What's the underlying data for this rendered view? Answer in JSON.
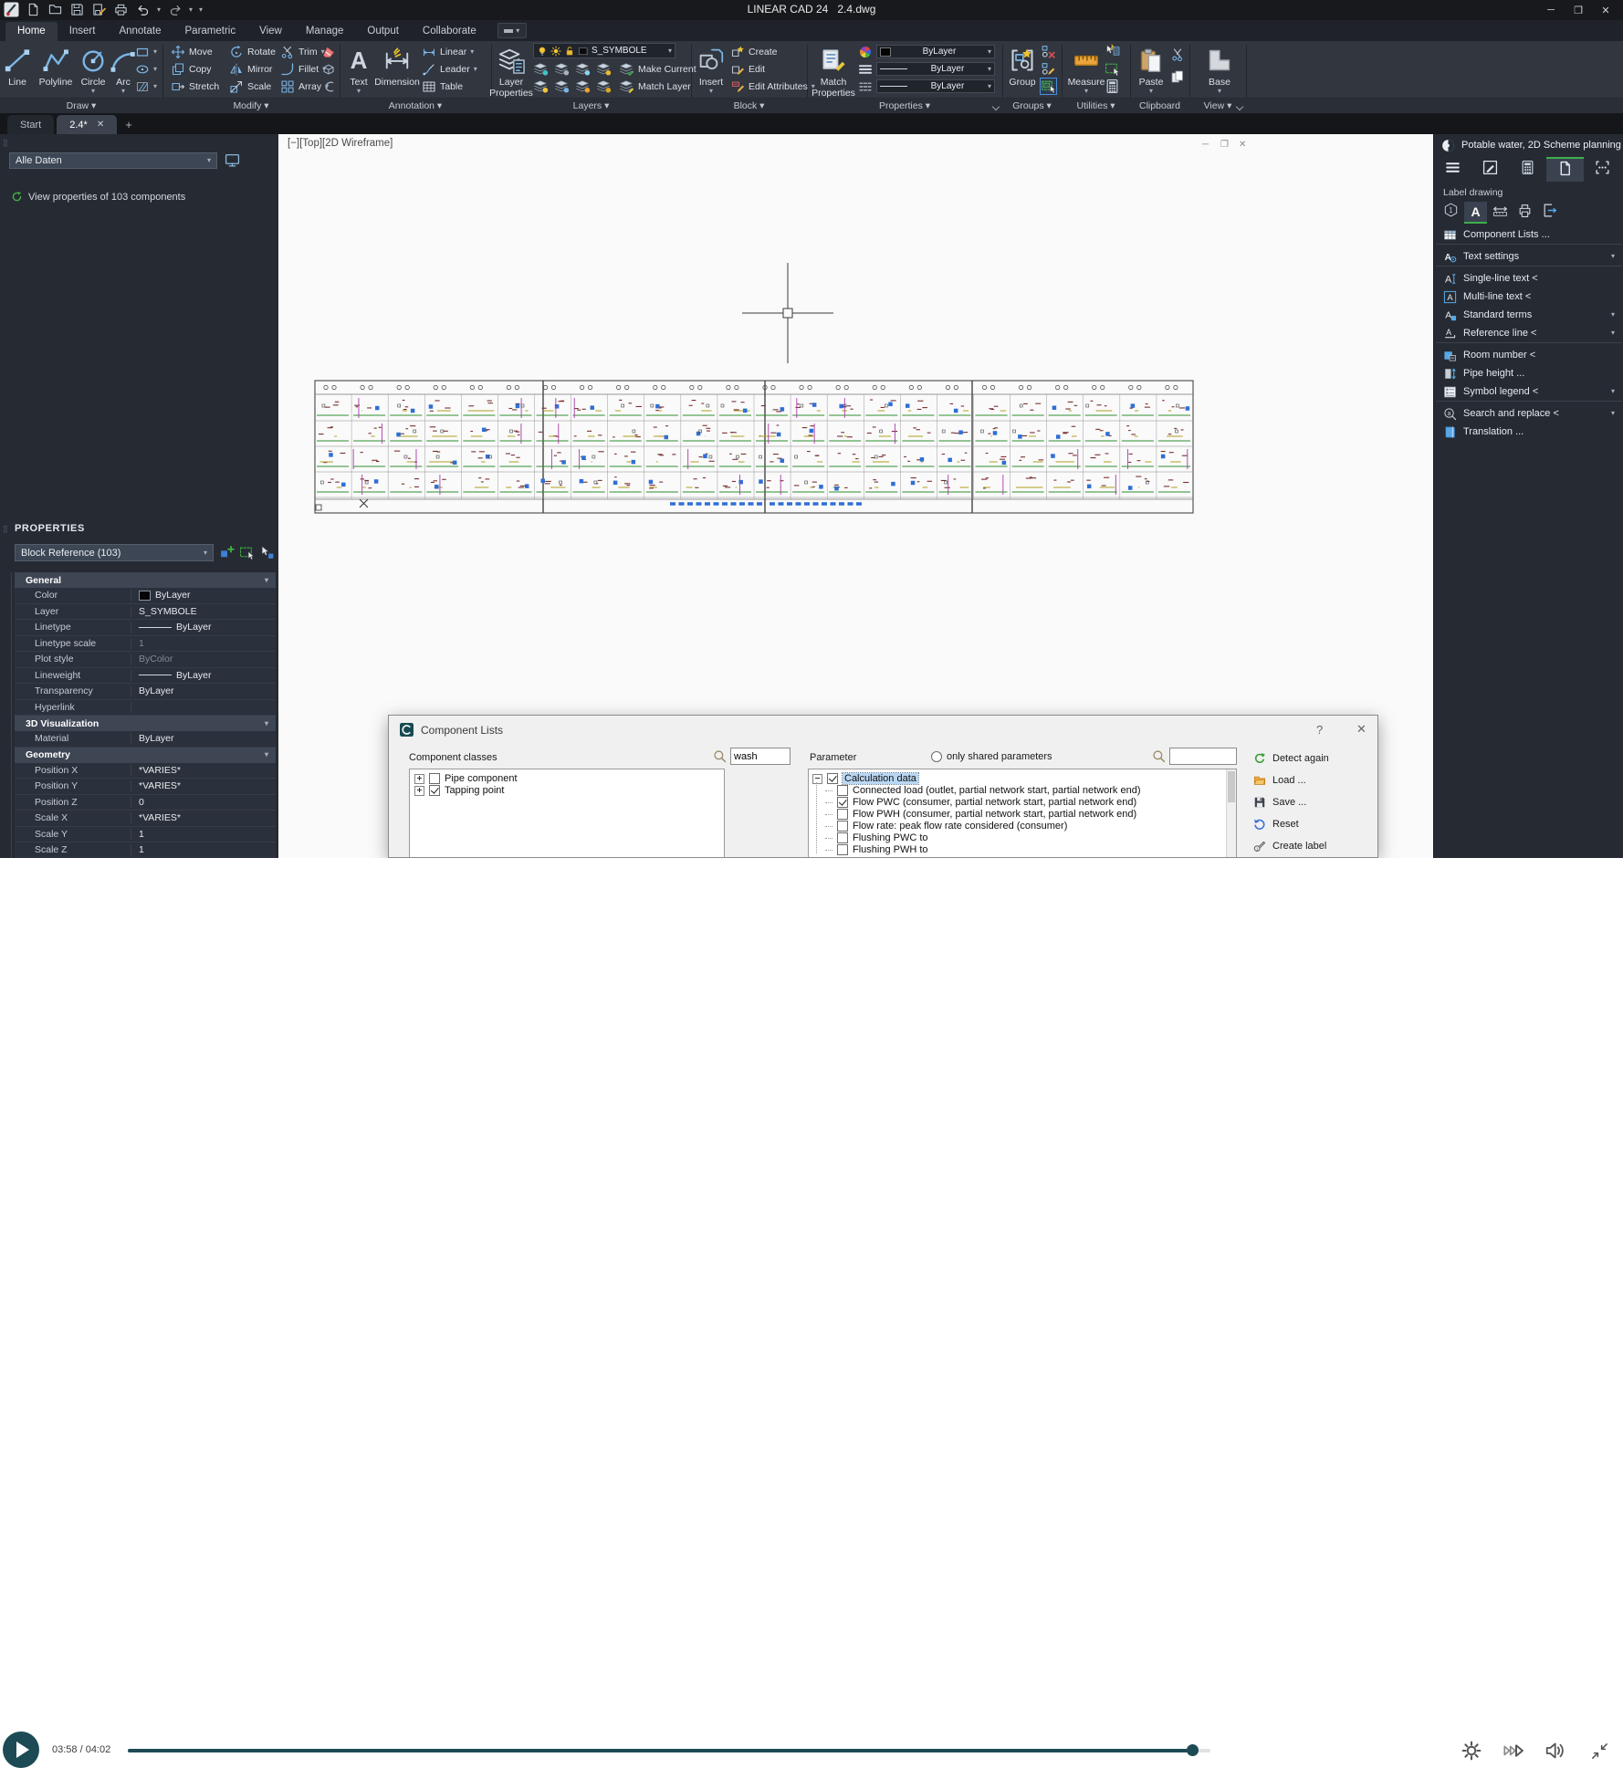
{
  "titlebar": {
    "app": "LINEAR CAD 24",
    "doc": "2.4.dwg"
  },
  "menubar": {
    "tabs": [
      "Home",
      "Insert",
      "Annotate",
      "Parametric",
      "View",
      "Manage",
      "Output",
      "Collaborate"
    ],
    "active_index": 0
  },
  "ribbon": {
    "groups": [
      {
        "label": "Draw",
        "chevron": true
      },
      {
        "label": "Modify",
        "chevron": true
      },
      {
        "label": "Annotation",
        "chevron": true
      },
      {
        "label": "Layers",
        "chevron": true
      },
      {
        "label": "Block",
        "chevron": true
      },
      {
        "label": "Properties",
        "chevron": true,
        "launcher": true
      },
      {
        "label": "Groups",
        "chevron": true
      },
      {
        "label": "Utilities",
        "chevron": true
      },
      {
        "label": "Clipboard",
        "chevron": false
      },
      {
        "label": "View",
        "chevron": true,
        "launcher": true
      }
    ],
    "draw": {
      "buttons": [
        {
          "label": "Line"
        },
        {
          "label": "Polyline"
        },
        {
          "label": "Circle",
          "menu": true
        },
        {
          "label": "Arc",
          "menu": true
        }
      ]
    },
    "modify": {
      "grid": [
        {
          "label": "Move"
        },
        {
          "label": "Rotate"
        },
        {
          "label": "Trim",
          "menu": true
        },
        {
          "label": "Copy"
        },
        {
          "label": "Mirror"
        },
        {
          "label": "Fillet",
          "menu": true
        },
        {
          "label": "Stretch"
        },
        {
          "label": "Scale"
        },
        {
          "label": "Array",
          "menu": true
        }
      ]
    },
    "annotation": {
      "text_label": "Text",
      "dimension_label": "Dimension",
      "list": [
        {
          "label": "Linear",
          "menu": true
        },
        {
          "label": "Leader",
          "menu": true
        },
        {
          "label": "Table"
        }
      ]
    },
    "layers": {
      "big_label": "Layer Properties",
      "combo_value": "S_SYMBOLE",
      "make_current": "Make Current",
      "match_layer": "Match Layer"
    },
    "block": {
      "big_label": "Insert",
      "list": [
        {
          "label": "Create"
        },
        {
          "label": "Edit"
        },
        {
          "label": "Edit Attributes",
          "menu": true
        }
      ]
    },
    "properties": {
      "big_label": "Match Properties",
      "combos": [
        "ByLayer",
        "ByLayer",
        "ByLayer"
      ]
    },
    "groups_panel": {
      "big_label": "Group"
    },
    "utilities": {
      "big_label": "Measure"
    },
    "clipboard": {
      "big_label": "Paste"
    },
    "view": {
      "big_label": "Base"
    }
  },
  "doc_tabs": {
    "tabs": [
      {
        "label": "Start",
        "active": false
      },
      {
        "label": "2.4*",
        "active": true,
        "closable": true
      }
    ],
    "new_tab_label": "+"
  },
  "left_panel": {
    "filter_value": "Alle Daten",
    "status": "View properties of 103 components",
    "palette_title": "PROPERTIES",
    "selection": "Block Reference (103)",
    "sections": [
      {
        "title": "General",
        "rows": [
          {
            "label": "Color",
            "value": "ByLayer",
            "swatch": true
          },
          {
            "label": "Layer",
            "value": "S_SYMBOLE"
          },
          {
            "label": "Linetype",
            "value": "ByLayer",
            "line": true
          },
          {
            "label": "Linetype scale",
            "value": "1",
            "dim": true
          },
          {
            "label": "Plot style",
            "value": "ByColor",
            "dim": true
          },
          {
            "label": "Lineweight",
            "value": "ByLayer",
            "line": true
          },
          {
            "label": "Transparency",
            "value": "ByLayer"
          },
          {
            "label": "Hyperlink",
            "value": ""
          }
        ]
      },
      {
        "title": "3D Visualization",
        "rows": [
          {
            "label": "Material",
            "value": "ByLayer"
          }
        ]
      },
      {
        "title": "Geometry",
        "rows": [
          {
            "label": "Position X",
            "value": "*VARIES*"
          },
          {
            "label": "Position Y",
            "value": "*VARIES*"
          },
          {
            "label": "Position Z",
            "value": "0"
          },
          {
            "label": "Scale X",
            "value": "*VARIES*"
          },
          {
            "label": "Scale Y",
            "value": "1"
          },
          {
            "label": "Scale Z",
            "value": "1"
          }
        ]
      }
    ]
  },
  "viewport": {
    "controls_label": "[−][Top][2D Wireframe]"
  },
  "right_panel": {
    "title": "Potable water, 2D Scheme planning",
    "section": "Label drawing",
    "items": [
      {
        "icon": "tablesmall",
        "label": "Component Lists ...",
        "sep_after": true
      },
      {
        "icon": "agear",
        "label": "Text settings",
        "chevron": true,
        "sep_after": true
      },
      {
        "icon": "acursor",
        "label": "Single-line text <"
      },
      {
        "icon": "abox",
        "label": "Multi-line text <"
      },
      {
        "icon": "asquare",
        "label": "Standard terms",
        "chevron": true
      },
      {
        "icon": "arefline",
        "label": "Reference line <",
        "chevron": true,
        "sep_after": true
      },
      {
        "icon": "roomnum",
        "label": "Room number <"
      },
      {
        "icon": "pipeheight",
        "label": "Pipe height ..."
      },
      {
        "icon": "legend",
        "label": "Symbol legend <",
        "chevron": true,
        "sep_after": true
      },
      {
        "icon": "searchat",
        "label": "Search and replace <",
        "chevron": true
      },
      {
        "icon": "book",
        "label": "Translation ..."
      }
    ]
  },
  "dialog": {
    "title": "Component Lists",
    "help_label": "?",
    "classes_label": "Component classes",
    "classes_search": "wash",
    "classes_tree": [
      {
        "label": "Pipe component",
        "checked": false
      },
      {
        "label": "Tapping point",
        "checked": true
      }
    ],
    "param_label": "Parameter",
    "shared_label": "only shared parameters",
    "param_search": "",
    "param_tree": [
      {
        "label": "Calculation data",
        "checked": true,
        "selected": true,
        "level": 0
      },
      {
        "label": "Connected load (outlet, partial network start, partial network end)",
        "checked": false,
        "level": 1
      },
      {
        "label": "Flow PWC (consumer, partial network start, partial network end)",
        "checked": true,
        "level": 1
      },
      {
        "label": "Flow PWH (consumer, partial network start, partial network end)",
        "checked": false,
        "level": 1
      },
      {
        "label": "Flow rate: peak flow rate considered (consumer)",
        "checked": false,
        "level": 1
      },
      {
        "label": "Flushing PWC to",
        "checked": false,
        "level": 1
      },
      {
        "label": "Flushing PWH to",
        "checked": false,
        "level": 1
      }
    ],
    "actions": [
      {
        "icon": "refresh",
        "label": "Detect again"
      },
      {
        "icon": "folder",
        "label": "Load ..."
      },
      {
        "icon": "savedisk",
        "label": "Save ..."
      },
      {
        "icon": "reset",
        "label": "Reset"
      },
      {
        "icon": "createlabel",
        "label": "Create label"
      }
    ]
  },
  "player": {
    "time": "03:58 / 04:02",
    "progress_pct": 98.3
  },
  "colors": {
    "accent_green": "#3fae4c",
    "teal": "#1d4b55",
    "selection_blue": "#2f6fd6",
    "ribbon_bg": "#31363f"
  }
}
